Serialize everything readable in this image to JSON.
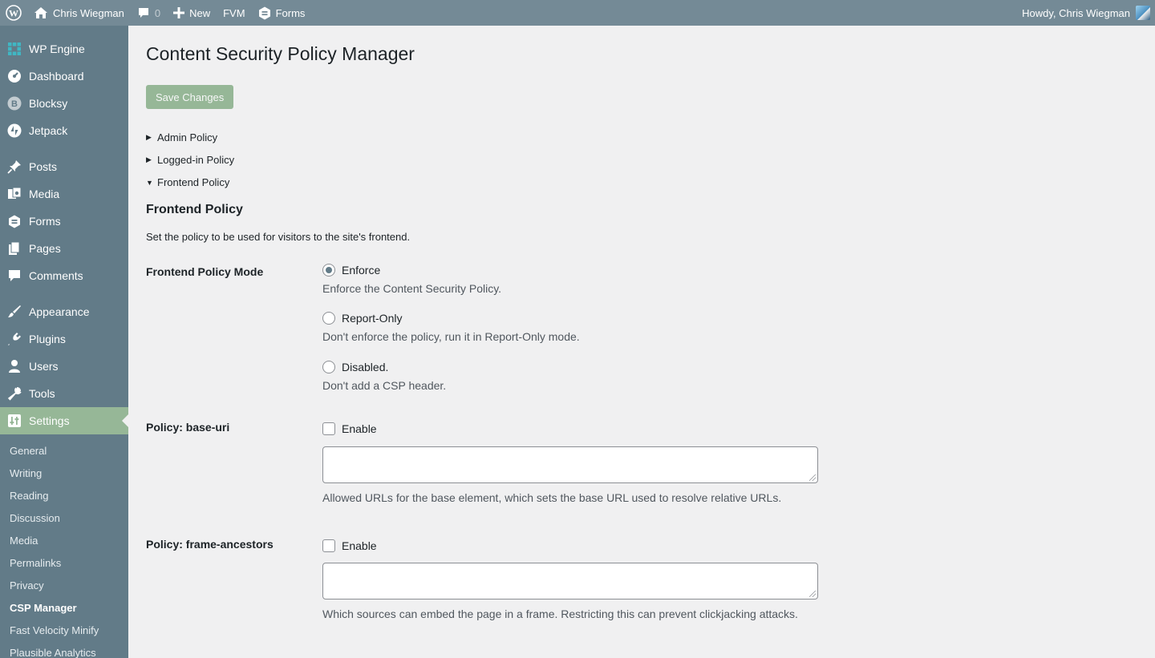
{
  "adminbar": {
    "site_name": "Chris Wiegman",
    "comments_count": "0",
    "new_label": "New",
    "fvm_label": "FVM",
    "forms_label": "Forms",
    "howdy": "Howdy, Chris Wiegman"
  },
  "sidebar": {
    "items": [
      {
        "label": "WP Engine",
        "icon": "wp-engine-icon"
      },
      {
        "label": "Dashboard",
        "icon": "dashboard-icon"
      },
      {
        "label": "Blocksy",
        "icon": "blocksy-icon"
      },
      {
        "label": "Jetpack",
        "icon": "jetpack-icon"
      },
      {
        "label": "Posts",
        "icon": "pin-icon"
      },
      {
        "label": "Media",
        "icon": "media-icon"
      },
      {
        "label": "Forms",
        "icon": "forms-icon"
      },
      {
        "label": "Pages",
        "icon": "pages-icon"
      },
      {
        "label": "Comments",
        "icon": "comment-icon"
      },
      {
        "label": "Appearance",
        "icon": "brush-icon"
      },
      {
        "label": "Plugins",
        "icon": "plugin-icon"
      },
      {
        "label": "Users",
        "icon": "user-icon"
      },
      {
        "label": "Tools",
        "icon": "wrench-icon"
      },
      {
        "label": "Settings",
        "icon": "settings-icon"
      }
    ],
    "submenu": [
      "General",
      "Writing",
      "Reading",
      "Discussion",
      "Media",
      "Permalinks",
      "Privacy",
      "CSP Manager",
      "Fast Velocity Minify",
      "Plausible Analytics"
    ]
  },
  "main": {
    "title": "Content Security Policy Manager",
    "save_label": "Save Changes",
    "policies": [
      "Admin Policy",
      "Logged-in Policy",
      "Frontend Policy"
    ],
    "section_title": "Frontend Policy",
    "section_desc": "Set the policy to be used for visitors to the site's frontend.",
    "mode": {
      "label": "Frontend Policy Mode",
      "selected": "Enforce",
      "options": [
        {
          "label": "Enforce",
          "desc": "Enforce the Content Security Policy."
        },
        {
          "label": "Report-Only",
          "desc": "Don't enforce the policy, run it in Report-Only mode."
        },
        {
          "label": "Disabled.",
          "desc": "Don't add a CSP header."
        }
      ]
    },
    "base_uri": {
      "label": "Policy: base-uri",
      "enable_label": "Enable",
      "value": "",
      "desc": "Allowed URLs for the base element, which sets the base URL used to resolve relative URLs."
    },
    "frame_ancestors": {
      "label": "Policy: frame-ancestors",
      "enable_label": "Enable",
      "value": "",
      "desc": "Which sources can embed the page in a frame. Restricting this can prevent clickjacking attacks."
    }
  },
  "colors": {
    "adminbar": "#748a96",
    "sidebar": "#627b88",
    "accent": "#96b797"
  }
}
